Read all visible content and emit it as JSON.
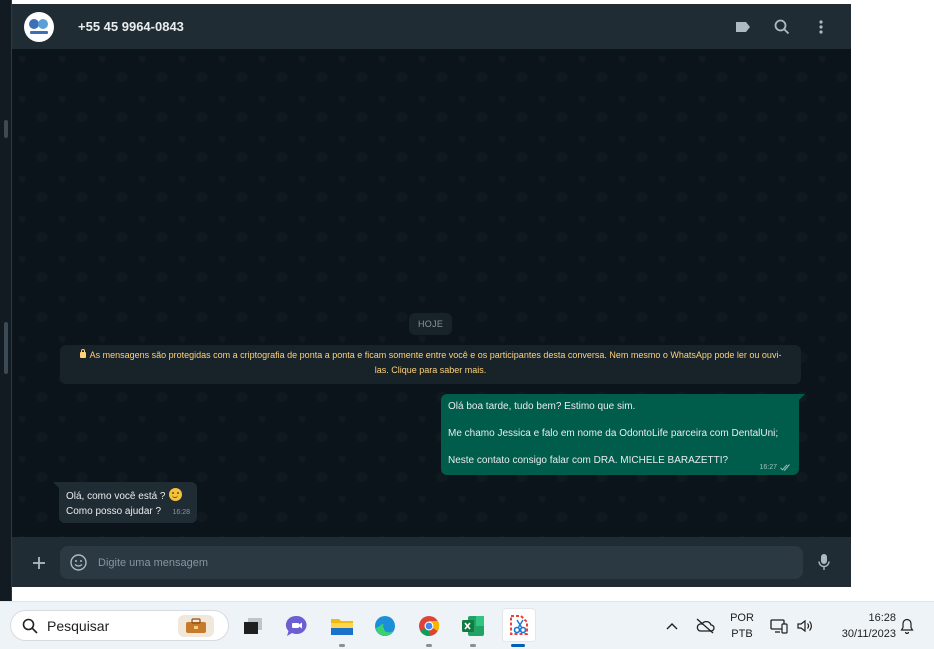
{
  "header": {
    "contact_name": "+55 45 9964-0843",
    "icons": [
      "label-icon",
      "search-icon",
      "menu-icon"
    ]
  },
  "chat": {
    "date_chip": "HOJE",
    "encryption_notice": "As mensagens são protegidas com a criptografia de ponta a ponta e ficam somente entre você e os participantes desta conversa. Nem mesmo o WhatsApp pode ler ou ouvi-las. Clique para saber mais.",
    "outgoing": {
      "lines": [
        "Olá boa tarde, tudo bem? Estimo que sim.",
        "Me chamo Jessica e falo em nome da OdontoLife parceira com DentalUni;",
        "Neste contato consigo falar com DRA. MICHELE BARAZETTI?"
      ],
      "time": "16:27"
    },
    "incoming": {
      "line1": "Olá, como você está ?",
      "line2": "Como posso ajudar ?",
      "time": "16:28"
    }
  },
  "composer": {
    "placeholder": "Digite uma mensagem"
  },
  "taskbar": {
    "search_placeholder": "Pesquisar",
    "language_top": "POR",
    "language_bottom": "PTB",
    "time": "16:28",
    "date": "30/11/2023"
  },
  "colors": {
    "header_bg": "#202c33",
    "chat_bg": "#0b141a",
    "outgoing_bubble": "#005c4b",
    "incoming_bubble": "#202c33",
    "notice_text": "#ffd279"
  }
}
